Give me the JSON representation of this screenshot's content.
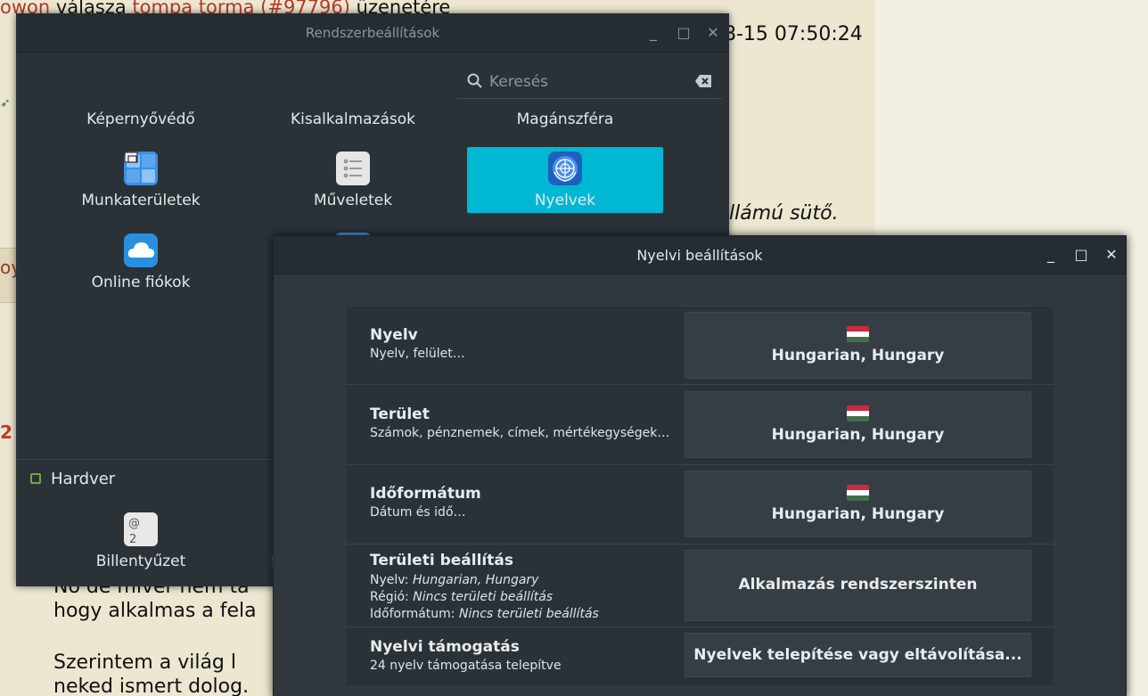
{
  "background": {
    "topline_user": "owon",
    "topline_mid": " válasza ",
    "topline_link": "tompa torma",
    "topline_ref": "(#97796)",
    "topline_end": " üzenetére",
    "date": "8-15 07:50:24",
    "sentence": "llámú sütő.",
    "oy": "oy",
    "two": "2",
    "p1": "No de miver nem ta",
    "p2": "hogy alkalmas a fela",
    "p3": "Szerintem a világ l",
    "p4": "neked ismert dolog."
  },
  "settings": {
    "title": "Rendszerbeállítások",
    "search_placeholder": "Keresés",
    "categories": [
      "Képernyővédő",
      "Kisalkalmazások",
      "Magánszféra"
    ],
    "tiles": {
      "workspaces": "Munkaterületek",
      "actions": "Műveletek",
      "languages": "Nyelvek",
      "online_accounts": "Online fiókok"
    },
    "hardware_section": "Hardver",
    "keyboard": "Billentyűzet",
    "partial": "l"
  },
  "language": {
    "title": "Nyelvi beállítások",
    "rows": {
      "language": {
        "head": "Nyelv",
        "sub": "Nyelv, felület…",
        "value": "Hungarian, Hungary"
      },
      "region": {
        "head": "Terület",
        "sub": "Számok, pénznemek, címek, mértékegységek…",
        "value": "Hungarian, Hungary"
      },
      "time": {
        "head": "Időformátum",
        "sub": "Dátum és idő…",
        "value": "Hungarian, Hungary"
      },
      "regional": {
        "head": "Területi beállítás",
        "l1_key": "Nyelv: ",
        "l1_val": "Hungarian, Hungary",
        "l2_key": "Régió: ",
        "l2_val": "Nincs területi beállítás",
        "l3_key": "Időformátum: ",
        "l3_val": "Nincs területi beállítás",
        "button": "Alkalmazás rendszerszinten"
      },
      "support": {
        "head": "Nyelvi támogatás",
        "sub": "24 nyelv támogatása telepítve",
        "button": "Nyelvek telepítése vagy eltávolítása..."
      }
    }
  },
  "colors": {
    "accent": "#00b8d4",
    "flag_red": "#cd2a3e",
    "flag_white": "#ffffff",
    "flag_green": "#436f4d"
  }
}
